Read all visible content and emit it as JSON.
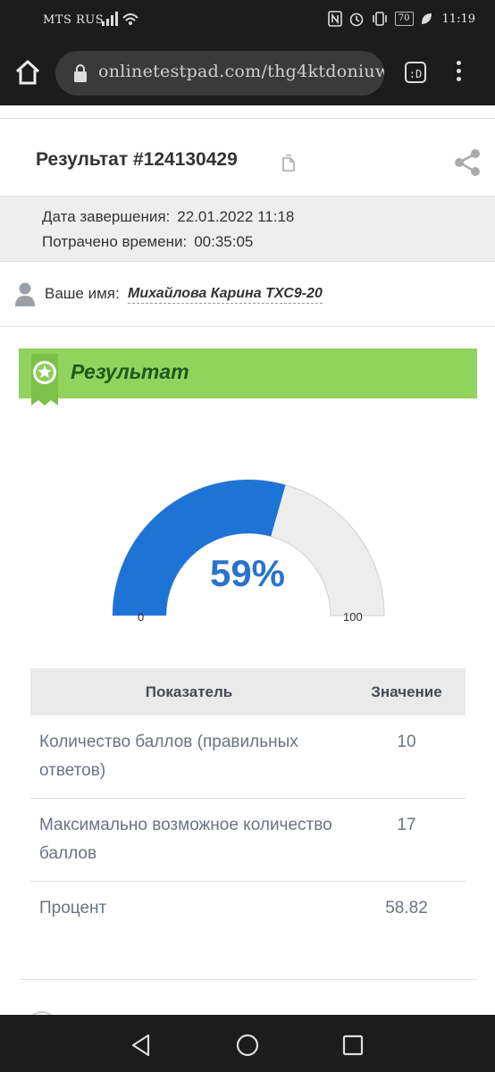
{
  "status_bar": {
    "carrier": "MTS RUS",
    "battery": "70",
    "time": "11:19"
  },
  "browser": {
    "url": "onlinetestpad.com/thg4ktdoniuw",
    "tabs_label": ":D"
  },
  "result_card": {
    "title": "Результат #124130429",
    "finish_label": "Дата завершения:",
    "finish_value": "22.01.2022 11:18",
    "time_label": "Потрачено времени:",
    "time_value": "00:35:05",
    "name_label": "Ваше имя:",
    "name_value": "Михайлова Карина ТХС9-20"
  },
  "result_banner": {
    "label": "Результат"
  },
  "gauge": {
    "value_text": "59%",
    "percent": 0.5882,
    "min": "0",
    "max": "100",
    "fill_color": "#1e73d6",
    "rest_color": "#ededed"
  },
  "table": {
    "headers": [
      "Показатель",
      "Значение"
    ],
    "rows": [
      {
        "label": "Количество баллов (правильных ответов)",
        "value": "10"
      },
      {
        "label": "Максимально возможное количество баллов",
        "value": "17"
      },
      {
        "label": "Процент",
        "value": "58.82"
      }
    ]
  },
  "icons": [
    "home-icon",
    "lock-icon",
    "tabs-icon",
    "menu-icon",
    "copy-icon",
    "share-icon",
    "user-icon",
    "badge-icon",
    "back-icon",
    "home-nav-icon",
    "recents-icon"
  ]
}
